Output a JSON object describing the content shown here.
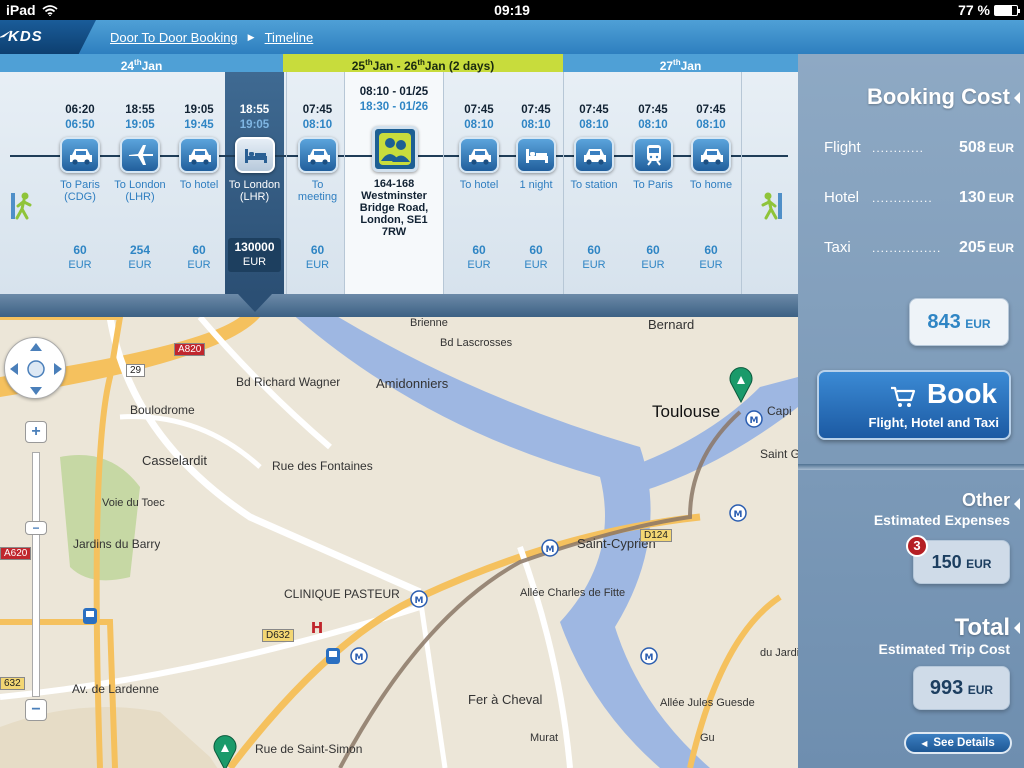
{
  "status_bar": {
    "device": "iPad",
    "time": "09:19",
    "battery": "77 %",
    "battery_level": 0.77
  },
  "nav": {
    "logo": "KDS",
    "breadcrumbs": [
      "Door To Door Booking",
      "Timeline"
    ]
  },
  "timeline": {
    "days": [
      {
        "label_pre": "24",
        "label_sup": "th",
        "label_post": "Jan",
        "color": "#4fa0d6"
      },
      {
        "label_pre": "25",
        "label_sup": "th",
        "label_mid": "Jan  -  26",
        "label_sup2": "th",
        "label_post": "Jan  (2 days)",
        "color": "#c8dc3c"
      },
      {
        "label_pre": "27",
        "label_sup": "th",
        "label_post": "Jan",
        "color": "#4fa0d6"
      }
    ],
    "segments": [
      {
        "t1": "06:20",
        "t2": "06:50",
        "icon": "taxi-icon",
        "dest": "To Paris (CDG)",
        "price": "60",
        "cur": "EUR"
      },
      {
        "t1": "18:55",
        "t2": "19:05",
        "icon": "plane-icon",
        "dest": "To London (LHR)",
        "price": "254",
        "cur": "EUR"
      },
      {
        "t1": "19:05",
        "t2": "19:45",
        "icon": "taxi-icon",
        "dest": "To hotel",
        "price": "60",
        "cur": "EUR"
      },
      {
        "t1": "18:55",
        "t2": "19:05",
        "icon": "bed-icon",
        "dest": "To London (LHR)",
        "price": "130000",
        "cur": "EUR",
        "selected": true
      },
      {
        "t1": "07:45",
        "t2": "08:10",
        "icon": "taxi-icon",
        "dest": "To meeting",
        "price": "60",
        "cur": "EUR"
      },
      {
        "t1": "08:10 - 01/25",
        "t2": "18:30 - 01/26",
        "icon": "meeting-icon",
        "dest": "164-168 Westminster Bridge Road, London, SE1 7RW",
        "price": "",
        "cur": ""
      },
      {
        "t1": "07:45",
        "t2": "08:10",
        "icon": "taxi-icon",
        "dest": "To hotel",
        "price": "60",
        "cur": "EUR"
      },
      {
        "t1": "07:45",
        "t2": "08:10",
        "icon": "bed-icon",
        "dest": "1 night",
        "price": "60",
        "cur": "EUR"
      },
      {
        "t1": "07:45",
        "t2": "08:10",
        "icon": "taxi-icon",
        "dest": "To station",
        "price": "60",
        "cur": "EUR"
      },
      {
        "t1": "07:45",
        "t2": "08:10",
        "icon": "train-icon",
        "dest": "To Paris",
        "price": "60",
        "cur": "EUR"
      },
      {
        "t1": "07:45",
        "t2": "08:10",
        "icon": "taxi-icon",
        "dest": "To home",
        "price": "60",
        "cur": "EUR"
      }
    ]
  },
  "map": {
    "labels": [
      "Bernard",
      "Toulouse",
      "Capi",
      "Saint Georg",
      "Amidonniers",
      "Boulodrome",
      "Casselardit",
      "Rue des Fontaines",
      "Voie du Toec",
      "Jardins du Barry",
      "CLINIQUE PASTEUR",
      "Saint-Cyprien",
      "Allée Charles de Fitte",
      "Av. de Lardenne",
      "Fer à Cheval",
      "Rue de Saint-Simon",
      "Bd Richard Wagner",
      "Bd Lascrosses",
      "Brienne",
      "A820",
      "A620",
      "D124",
      "D632",
      "632",
      "29",
      "Murat",
      "Allée Jules Guesde",
      "du Jardin",
      "Gu"
    ]
  },
  "booking": {
    "title": "Booking Cost",
    "items": [
      {
        "label": "Flight",
        "dots": "............",
        "value": "508",
        "cur": "EUR"
      },
      {
        "label": "Hotel",
        "dots": "..............",
        "value": "130",
        "cur": "EUR"
      },
      {
        "label": "Taxi",
        "dots": "................",
        "value": "205",
        "cur": "EUR"
      }
    ],
    "total": "843",
    "total_cur": "EUR",
    "book_label": "Book",
    "book_sub": "Flight, Hotel and Taxi"
  },
  "other": {
    "title": "Other",
    "subtitle": "Estimated Expenses",
    "badge": "3",
    "value": "150",
    "cur": "EUR"
  },
  "total": {
    "title": "Total",
    "subtitle": "Estimated Trip Cost",
    "value": "993",
    "cur": "EUR",
    "details_label": "See Details"
  }
}
